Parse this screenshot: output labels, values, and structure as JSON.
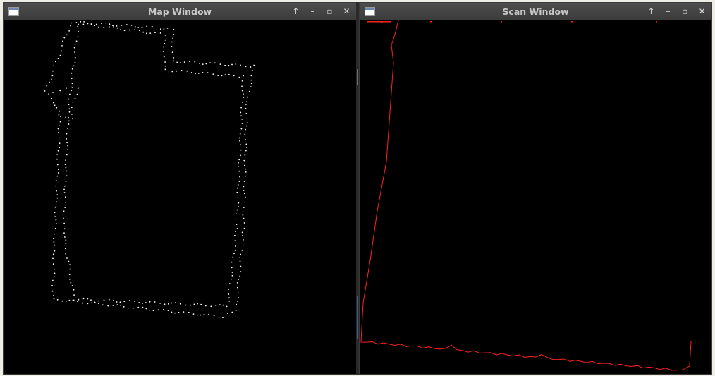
{
  "map_window": {
    "title": "Map Window",
    "controls": [
      {
        "name": "maximize-up-icon",
        "glyph": "↑"
      },
      {
        "name": "minimize-icon",
        "glyph": "–"
      },
      {
        "name": "restore-icon",
        "glyph": "▫"
      },
      {
        "name": "close-icon",
        "glyph": "✕"
      }
    ],
    "point_color": "#ffffff"
  },
  "scan_window": {
    "title": "Scan Window",
    "controls": [
      {
        "name": "maximize-up-icon",
        "glyph": "↑"
      },
      {
        "name": "minimize-icon",
        "glyph": "–"
      },
      {
        "name": "restore-icon",
        "glyph": "▫"
      },
      {
        "name": "close-icon",
        "glyph": "✕"
      }
    ],
    "scan_color": "#ff2020"
  },
  "colors": {
    "titlebar": "#444444",
    "canvas": "#000000",
    "title_text": "#c8c8c8"
  }
}
